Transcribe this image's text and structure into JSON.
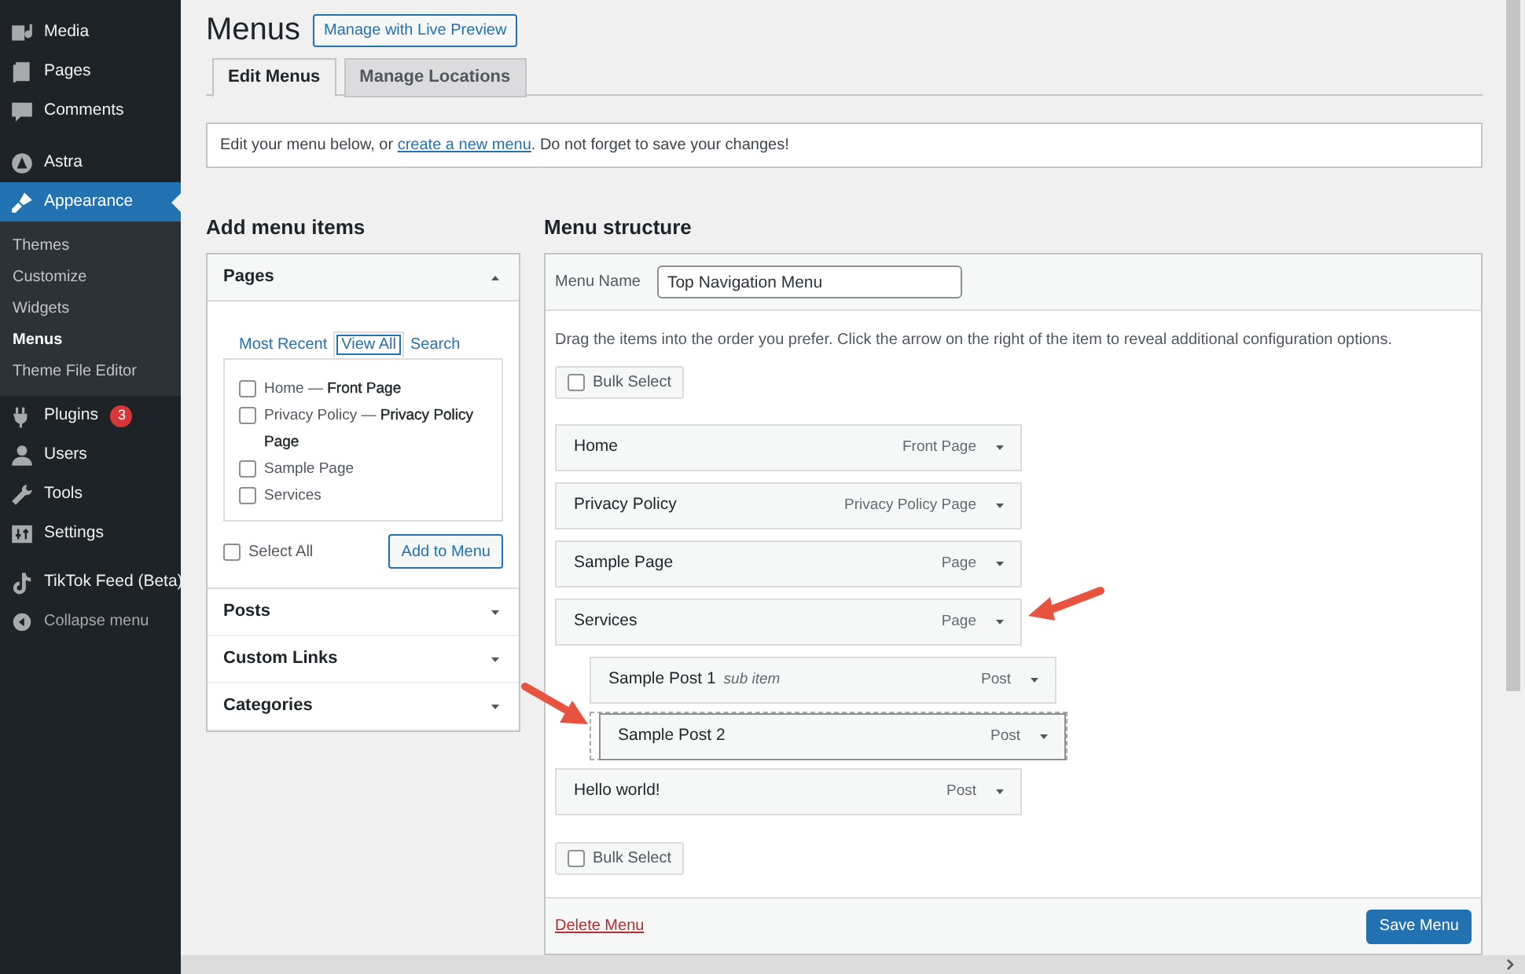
{
  "sidebar": {
    "groups": [
      [
        {
          "label": "Media",
          "selected": false
        },
        {
          "label": "Pages",
          "selected": false
        },
        {
          "label": "Comments",
          "selected": false
        }
      ],
      [
        {
          "label": "Astra",
          "selected": false
        },
        {
          "label": "Appearance",
          "selected": true,
          "submenu": [
            {
              "label": "Themes",
              "selected": false
            },
            {
              "label": "Customize",
              "selected": false
            },
            {
              "label": "Widgets",
              "selected": false
            },
            {
              "label": "Menus",
              "selected": true
            },
            {
              "label": "Theme File Editor",
              "selected": false
            }
          ]
        }
      ],
      [
        {
          "label": "Plugins",
          "selected": false,
          "badge": "3"
        },
        {
          "label": "Users",
          "selected": false
        },
        {
          "label": "Tools",
          "selected": false
        },
        {
          "label": "Settings",
          "selected": false
        }
      ],
      [
        {
          "label": "TikTok Feed (Beta)",
          "selected": false
        }
      ]
    ],
    "collapse": "Collapse menu"
  },
  "page": {
    "title": "Menus",
    "action": "Manage with Live Preview"
  },
  "tabs": [
    {
      "label": "Edit Menus",
      "selected": true
    },
    {
      "label": "Manage Locations",
      "selected": false
    }
  ],
  "notice": {
    "before": "Edit your menu below, or ",
    "link": "create a new menu",
    "after": ". Do not forget to save your changes!"
  },
  "add_items": {
    "heading": "Add menu items",
    "sections": [
      {
        "title": "Pages",
        "expanded": true
      },
      {
        "title": "Posts",
        "expanded": false
      },
      {
        "title": "Custom Links",
        "expanded": false
      },
      {
        "title": "Categories",
        "expanded": false
      }
    ],
    "tabs": [
      {
        "label": "Most Recent",
        "selected": false
      },
      {
        "label": "View All",
        "selected": true
      },
      {
        "label": "Search",
        "selected": false
      }
    ],
    "pages": [
      {
        "label": "Home — **Front Page**",
        "checked": false
      },
      {
        "label": "Privacy Policy — **Privacy Policy Page**",
        "checked": false
      },
      {
        "label": "Sample Page",
        "checked": false
      },
      {
        "label": "Services",
        "checked": false
      }
    ],
    "select_all": {
      "label": "Select All",
      "checked": false
    },
    "add_button": "Add to Menu"
  },
  "structure": {
    "heading": "Menu structure",
    "name_label": "Menu Name",
    "name_value": "Top Navigation Menu",
    "instructions": "Drag the items into the order you prefer. Click the arrow on the right of the item to reveal additional configuration options.",
    "bulk_select_top": {
      "label": "Bulk Select",
      "checked": false
    },
    "items": [
      {
        "title": "Home",
        "type": "Front Page"
      },
      {
        "title": "Privacy Policy",
        "type": "Privacy Policy Page"
      },
      {
        "title": "Sample Page",
        "type": "Page"
      },
      {
        "title": "Services",
        "type": "Page",
        "children": [
          {
            "title": "Sample Post 1",
            "note": "sub item",
            "type": "Post",
            "dragging": false
          },
          {
            "title": "Sample Post 2",
            "type": "Post",
            "dragging": true
          }
        ]
      },
      {
        "title": "Hello world!",
        "type": "Post"
      }
    ],
    "bulk_select_bottom": {
      "label": "Bulk Select",
      "checked": false
    },
    "delete": "Delete Menu",
    "save": "Save Menu"
  }
}
